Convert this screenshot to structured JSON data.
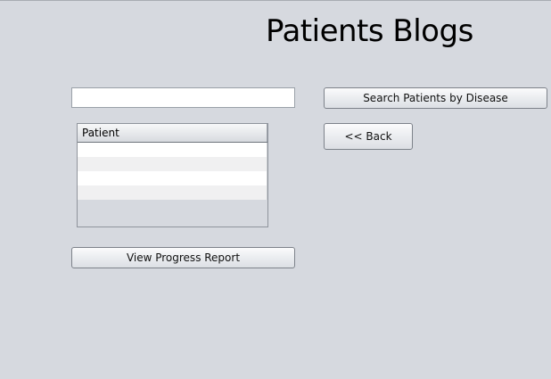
{
  "header": {
    "title": "Patients Blogs"
  },
  "search": {
    "value": "",
    "placeholder": "",
    "button_label": "Search Patients by Disease"
  },
  "navigation": {
    "back_label": "<< Back"
  },
  "patients_table": {
    "columns": [
      "Patient"
    ],
    "rows": [
      "",
      "",
      "",
      ""
    ]
  },
  "actions": {
    "progress_label": "View Progress Report"
  }
}
